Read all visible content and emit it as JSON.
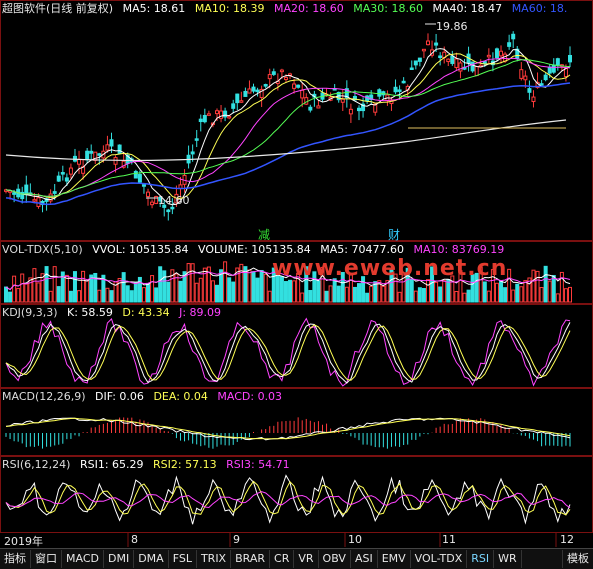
{
  "title": "超图软件(日线 前复权)",
  "ma": [
    {
      "label": "MA5: 18.61",
      "color": "#ffffff"
    },
    {
      "label": "MA10: 18.39",
      "color": "#ffff55"
    },
    {
      "label": "MA20: 18.60",
      "color": "#ff44ff"
    },
    {
      "label": "MA30: 18.60",
      "color": "#55ff55"
    },
    {
      "label": "MA40: 18.47",
      "color": "#ffffff"
    },
    {
      "label": "MA60: 18.",
      "color": "#3355ff"
    }
  ],
  "annotations": {
    "high": "19.86",
    "low": "14.60",
    "event1": "减",
    "event2": "财"
  },
  "vol": {
    "name": "VOL-TDX(5,10)",
    "items": [
      {
        "label": "VVOL: 105135.84",
        "color": "#ffffff"
      },
      {
        "label": "VOLUME: 105135.84",
        "color": "#ffffff"
      },
      {
        "label": "MA5: 70477.60",
        "color": "#ffffff"
      },
      {
        "label": "MA10: 83769.19",
        "color": "#ff44ff"
      }
    ]
  },
  "kdj": {
    "name": "KDJ(9,3,3)",
    "items": [
      {
        "label": "K: 58.59",
        "color": "#ffffff"
      },
      {
        "label": "D: 43.34",
        "color": "#ffff55"
      },
      {
        "label": "J: 89.09",
        "color": "#ff44ff"
      }
    ]
  },
  "macd": {
    "name": "MACD(12,26,9)",
    "items": [
      {
        "label": "DIF: 0.06",
        "color": "#ffffff"
      },
      {
        "label": "DEA: 0.04",
        "color": "#ffff55"
      },
      {
        "label": "MACD: 0.03",
        "color": "#ff44ff"
      }
    ]
  },
  "rsi": {
    "name": "RSI(6,12,24)",
    "items": [
      {
        "label": "RSI1: 65.29",
        "color": "#ffffff"
      },
      {
        "label": "RSI2: 57.13",
        "color": "#ffff55"
      },
      {
        "label": "RSI3: 54.71",
        "color": "#ff44ff"
      }
    ]
  },
  "watermark": "www.eweb.net.cn",
  "dates": [
    "2019年",
    "8",
    "9",
    "10",
    "11",
    "12"
  ],
  "tabs": [
    "指标",
    "窗口",
    "MACD",
    "DMI",
    "DMA",
    "FSL",
    "TRIX",
    "BRAR",
    "CR",
    "VR",
    "OBV",
    "ASI",
    "EMV",
    "VOL-TDX",
    "RSI",
    "WR"
  ],
  "active_tab": "RSI",
  "right_tab": "模板"
}
